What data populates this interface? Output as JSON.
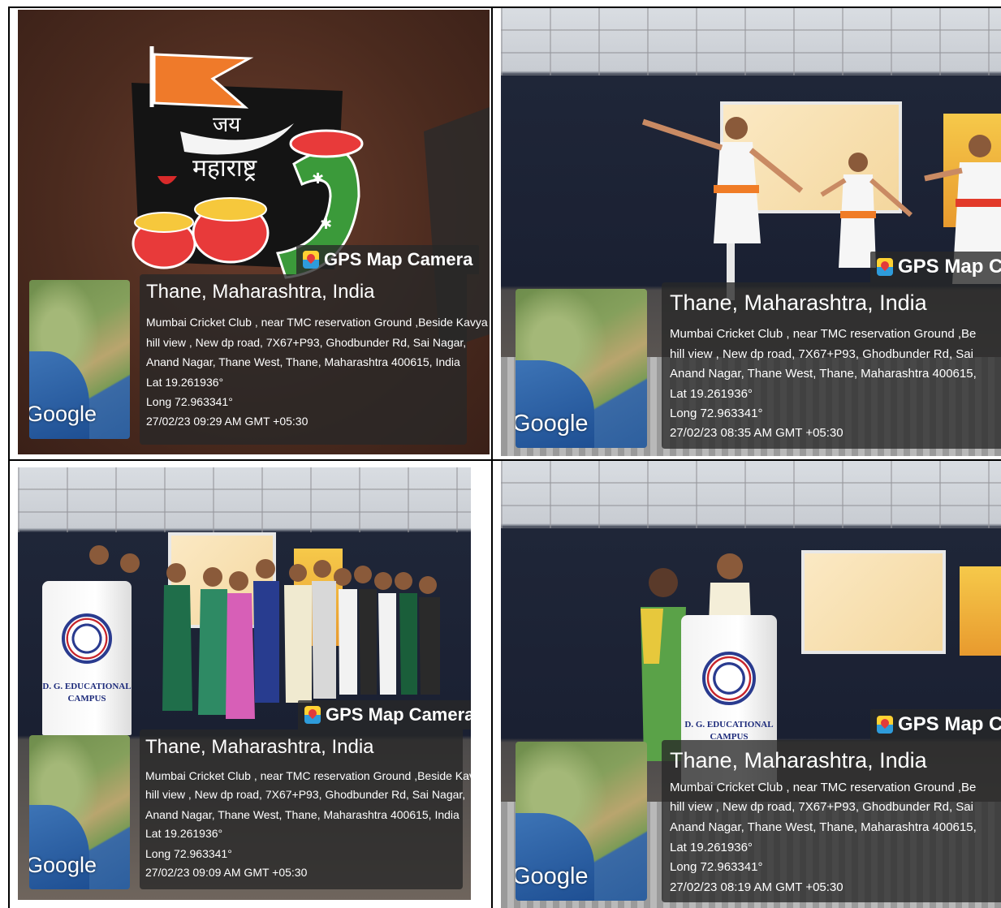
{
  "photos": [
    {
      "badge": "GPS Map Camera",
      "location": "Thane, Maharashtra, India",
      "address_line1": "Mumbai Cricket Club , near TMC reservation Ground ,Beside Kavya",
      "address_line2": "hill view , New dp road, 7X67+P93, Ghodbunder Rd, Sai Nagar,",
      "address_line3": "Anand Nagar, Thane West, Thane, Maharashtra 400615, India",
      "lat": "Lat 19.261936°",
      "long": "Long 72.963341°",
      "timestamp": "27/02/23 09:29 AM GMT +05:30",
      "map_label": "Google",
      "rangoli_text_1": "जय",
      "rangoli_text_2": "महाराष्ट्र"
    },
    {
      "badge": "GPS Map C",
      "location": "Thane, Maharashtra, India",
      "address_line1": "Mumbai Cricket Club , near TMC reservation Ground ,Be",
      "address_line2": "hill view , New dp road, 7X67+P93, Ghodbunder Rd, Sai",
      "address_line3": "Anand Nagar, Thane West, Thane, Maharashtra 400615,",
      "lat": "Lat 19.261936°",
      "long": "Long 72.963341°",
      "timestamp": "27/02/23 08:35 AM GMT +05:30",
      "map_label": "Google"
    },
    {
      "badge": "GPS Map Camera",
      "location": "Thane, Maharashtra, India",
      "address_line1": "Mumbai Cricket Club , near TMC reservation Ground ,Beside Kavya",
      "address_line2": "hill view , New dp road, 7X67+P93, Ghodbunder Rd, Sai Nagar,",
      "address_line3": "Anand Nagar, Thane West, Thane, Maharashtra 400615, India",
      "lat": "Lat 19.261936°",
      "long": "Long 72.963341°",
      "timestamp": "27/02/23 09:09 AM GMT +05:30",
      "map_label": "Google",
      "podium_line1": "D. G. EDUCATIONAL",
      "podium_line2": "CAMPUS"
    },
    {
      "badge": "GPS Map C",
      "location": "Thane, Maharashtra, India",
      "address_line1": "Mumbai Cricket Club , near TMC reservation Ground ,Be",
      "address_line2": "hill view , New dp road, 7X67+P93, Ghodbunder Rd, Sai",
      "address_line3": "Anand Nagar, Thane West, Thane, Maharashtra 400615,",
      "lat": "Lat 19.261936°",
      "long": "Long 72.963341°",
      "timestamp": "27/02/23 08:19 AM GMT +05:30",
      "map_label": "Google",
      "podium_line1": "D. G. EDUCATIONAL",
      "podium_line2": "CAMPUS"
    }
  ]
}
